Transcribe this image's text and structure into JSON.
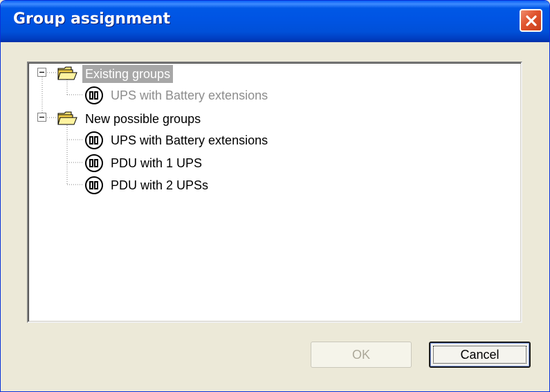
{
  "window": {
    "title": "Group assignment"
  },
  "tree": {
    "existing": {
      "label": "Existing groups",
      "children": [
        {
          "label": "UPS with Battery extensions"
        }
      ]
    },
    "new": {
      "label": "New possible groups",
      "children": [
        {
          "label": "UPS with Battery extensions"
        },
        {
          "label": "PDU with 1 UPS"
        },
        {
          "label": "PDU with 2 UPSs"
        }
      ]
    }
  },
  "buttons": {
    "ok": "OK",
    "cancel": "Cancel"
  },
  "icons": {
    "folder": "folder-open-icon",
    "device": "ups-device-icon",
    "expander": "collapse-minus-icon",
    "close": "close-icon"
  },
  "colors": {
    "titlebar": "#0054e3",
    "close": "#e0532d",
    "selection": "#a7a7a7",
    "dialog": "#ece9d8"
  }
}
